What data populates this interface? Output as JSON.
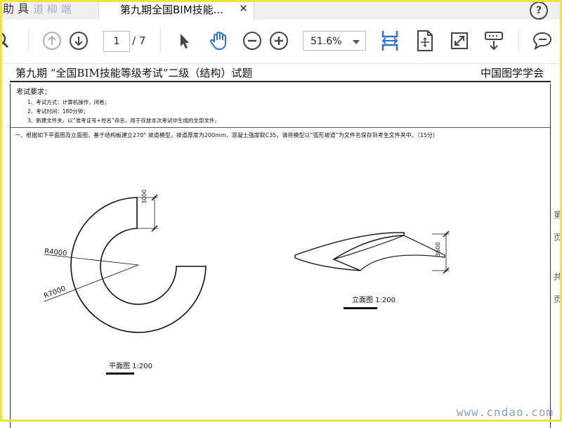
{
  "tabs": {
    "left_fragment": "助 具",
    "left_watermark": "道 柳 端",
    "active_title": "第九期全国BIM技能...",
    "close_glyph": "✕",
    "help_glyph": "?"
  },
  "toolbar": {
    "current_page": "1",
    "total_pages": "/ 7",
    "zoom": "51.6%"
  },
  "document": {
    "title": "第九期 “全国BIM技能等级考试”二级（结构）试题",
    "org": "中国图学学会",
    "req_head": "考试要求：",
    "requirements": [
      "1、考试方式：计算机操作，闭卷；",
      "2、考试时间：180分钟；",
      "3、新建文件夹，以“准考证号+姓名”命名，用于存放本次考试中生成的全部文件。"
    ],
    "question1": "一、根据如下平面图及立面图，基于结构板建立270° 坡道模型，坡道厚度为200mm，混凝土强度取C35，请将模型以“弧形坡道”为文件名保存到考生文件夹中。（15分）",
    "plan": {
      "dim": "3000",
      "r_inner": "R4000",
      "r_outer": "R7000",
      "caption": "平面图  1:200"
    },
    "elevation": {
      "dim": "3600",
      "caption": "立面图  1:200"
    },
    "right_edge": [
      "第",
      "页",
      "共",
      "页"
    ]
  },
  "watermark": "www.cndao.com"
}
